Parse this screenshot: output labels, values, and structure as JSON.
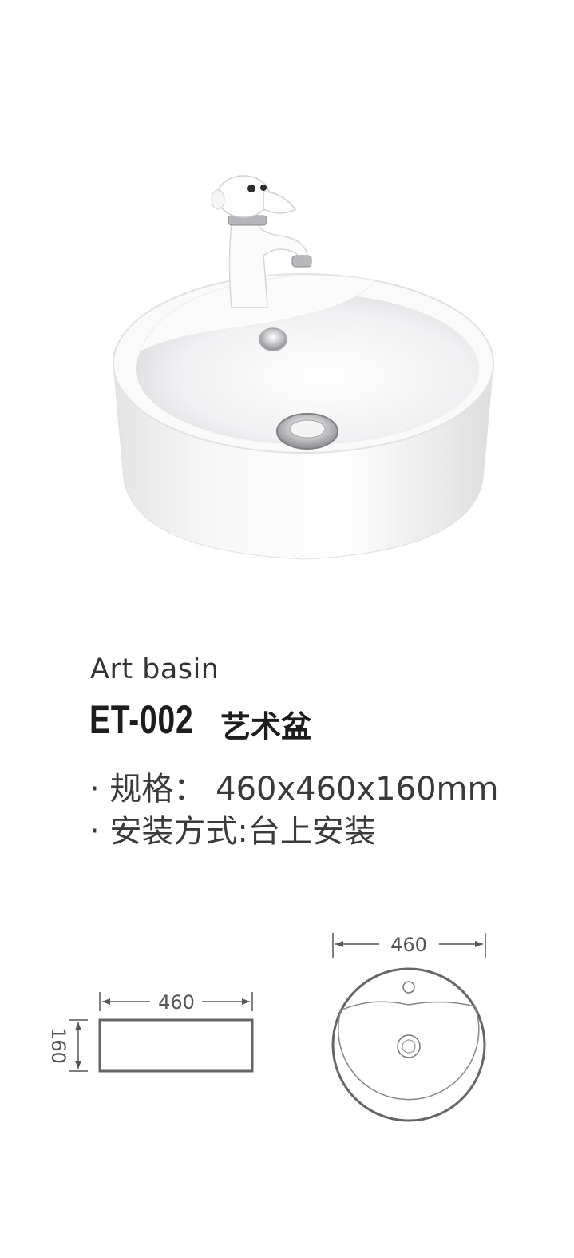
{
  "product": {
    "subtitle": "Art basin",
    "model": "ET-002",
    "name_cn": "艺术盆",
    "specs": [
      "· 规格： 460x460x160mm",
      "· 安装方式:台上安装"
    ]
  },
  "drawings": {
    "side_width": "460",
    "side_height": "160",
    "top_width": "460"
  }
}
